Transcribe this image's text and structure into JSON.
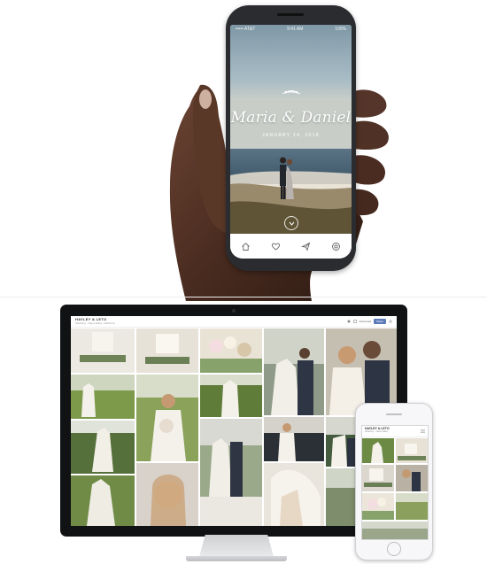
{
  "mobile_app": {
    "status_left": "••••• AT&T",
    "status_time": "9:41 AM",
    "status_right": "100%",
    "couple_names": "Maria & Daniel",
    "wedding_date": "JANUARY 14, 2018",
    "tab_bar": [
      "home-icon",
      "heart-icon",
      "send-icon",
      "camera-icon"
    ]
  },
  "desktop_site": {
    "brand": "HAYLEY & LETO",
    "subtitle": "Wedding · Napa Valley, California",
    "download_label": "Download",
    "share_label": "Share",
    "photo_count": 20
  },
  "small_phone_site": {
    "brand": "HAYLEY & LETO",
    "subtitle": "Wedding · Napa Valley"
  },
  "colors": {
    "sky": "#8fa9b6",
    "ocean": "#47647a",
    "sand": "#c9b9a6",
    "vineyard": "#6e8e3f",
    "dress": "#f2efe9",
    "suit": "#2c3340",
    "device_dark": "#2b2c30",
    "accent_button": "#5a7ab8"
  }
}
